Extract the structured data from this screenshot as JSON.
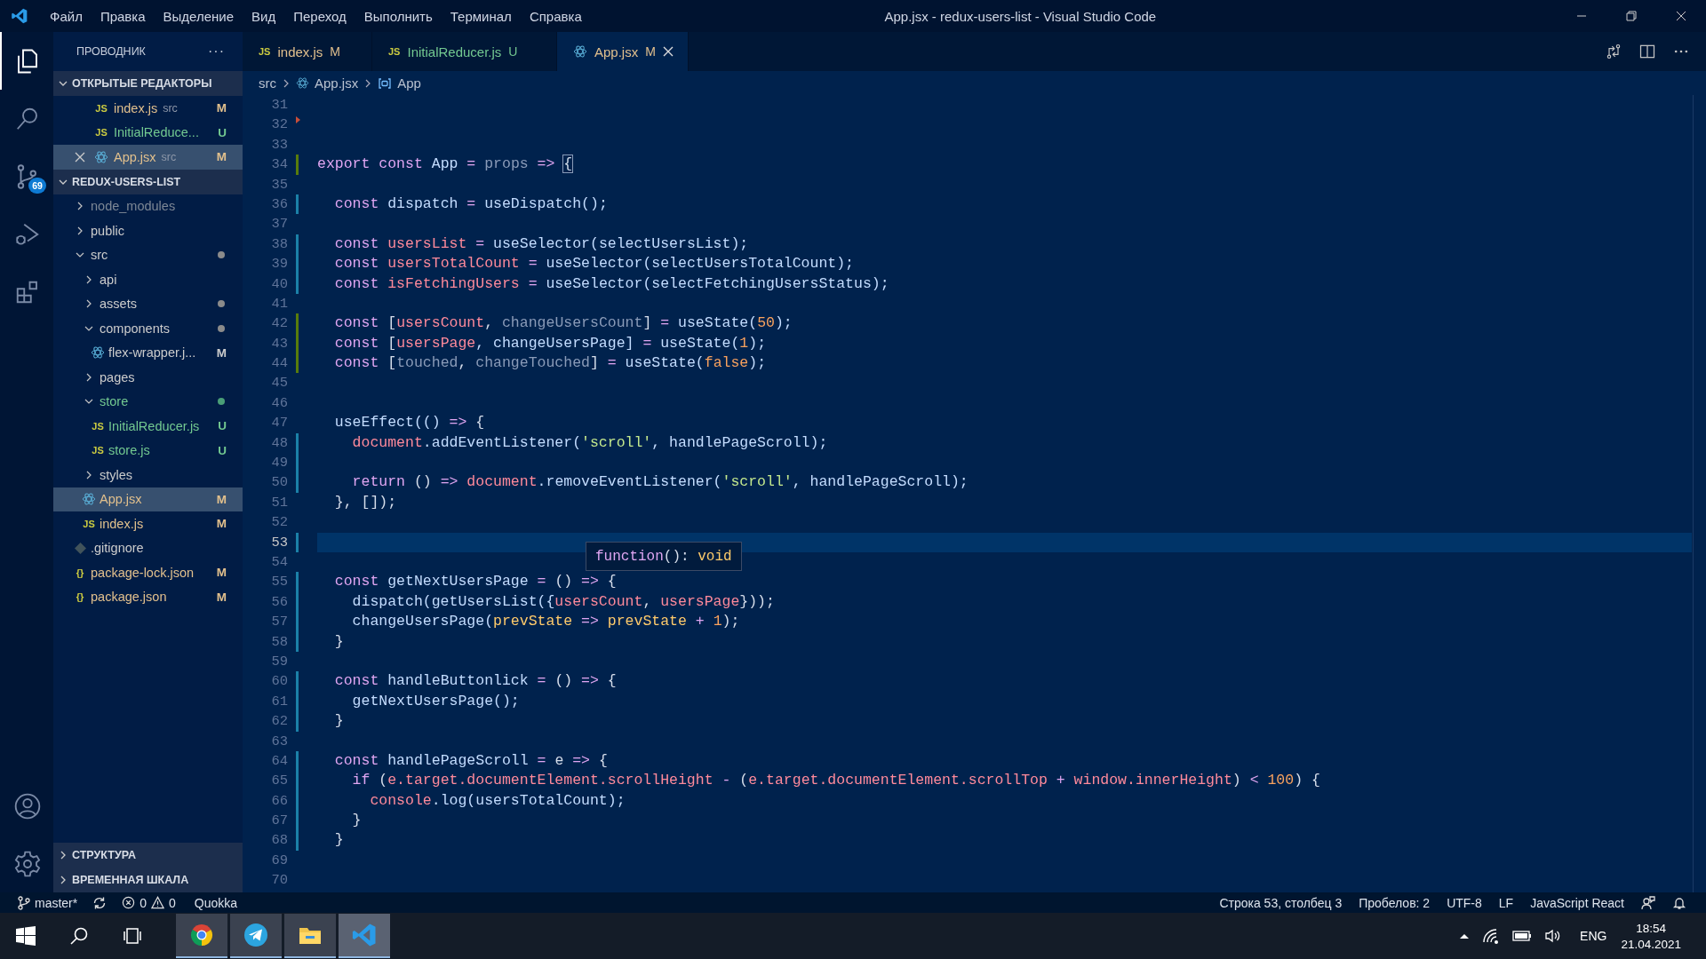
{
  "title_bar": {
    "menu": [
      "Файл",
      "Правка",
      "Выделение",
      "Вид",
      "Переход",
      "Выполнить",
      "Терминал",
      "Справка"
    ],
    "title": "App.jsx - redux-users-list - Visual Studio Code"
  },
  "activity_bar": {
    "items": [
      {
        "kind": "files",
        "selected": true
      },
      {
        "kind": "search",
        "selected": false
      },
      {
        "kind": "source-control",
        "selected": false,
        "badge": "69"
      },
      {
        "kind": "run",
        "selected": false
      },
      {
        "kind": "extensions",
        "selected": false
      }
    ],
    "bottom": [
      {
        "kind": "account"
      },
      {
        "kind": "gear"
      }
    ]
  },
  "explorer": {
    "title": "ПРОВОДНИК",
    "more": "···",
    "open_editors": {
      "title": "ОТКРЫТЫЕ РЕДАКТОРЫ",
      "expanded": true,
      "items": [
        {
          "name": "index.js",
          "description": "src",
          "status": "M",
          "color": "#e2c08d",
          "kind": "js",
          "icon_label": "JS",
          "selected": false
        },
        {
          "name": "InitialReduce...",
          "status": "U",
          "color": "#73c991",
          "kind": "js",
          "icon_label": "JS",
          "selected": false
        },
        {
          "name": "App.jsx",
          "description": "src",
          "status": "M",
          "color": "#e2c08d",
          "kind": "react",
          "selected": true
        }
      ]
    },
    "project": {
      "title": "REDUX-USERS-LIST",
      "expanded": true,
      "tree": [
        {
          "name": "node_modules",
          "kind": "folder",
          "expanded": false,
          "color": "#7d8795",
          "selected": false
        },
        {
          "name": "public",
          "kind": "folder",
          "expanded": false,
          "color": "#cccccc",
          "selected": false
        },
        {
          "name": "src",
          "kind": "folder",
          "expanded": true,
          "color": "#cccccc",
          "dot": {
            "color": "#8b8b8b"
          },
          "selected": false,
          "children": [
            {
              "name": "api",
              "kind": "folder",
              "expanded": false,
              "color": "#cccccc",
              "selected": false
            },
            {
              "name": "assets",
              "kind": "folder",
              "expanded": false,
              "color": "#cccccc",
              "dot": {
                "color": "#8b8b8b"
              },
              "selected": false
            },
            {
              "name": "components",
              "kind": "folder",
              "expanded": true,
              "color": "#cccccc",
              "dot": {
                "color": "#8b8b8b"
              },
              "selected": false,
              "children": [
                {
                  "name": "flex-wrapper.j...",
                  "kind": "react",
                  "color": "#cccccc",
                  "status": "M",
                  "selected": false
                }
              ]
            },
            {
              "name": "pages",
              "kind": "folder",
              "expanded": false,
              "color": "#cccccc",
              "selected": false
            },
            {
              "name": "store",
              "kind": "folder",
              "expanded": true,
              "color": "#73c991",
              "dot": {
                "color": "#4a9e77"
              },
              "selected": false,
              "children": [
                {
                  "name": "InitialReducer.js",
                  "kind": "js",
                  "icon_label": "JS",
                  "color": "#73c991",
                  "status": "U",
                  "selected": false
                },
                {
                  "name": "store.js",
                  "kind": "js",
                  "icon_label": "JS",
                  "color": "#73c991",
                  "status": "U",
                  "selected": false
                }
              ]
            },
            {
              "name": "styles",
              "kind": "folder",
              "expanded": false,
              "color": "#cccccc",
              "selected": false
            },
            {
              "name": "App.jsx",
              "kind": "react",
              "color": "#e2c08d",
              "status": "M",
              "selected": true
            },
            {
              "name": "index.js",
              "kind": "js",
              "icon_label": "JS",
              "color": "#e2c08d",
              "status": "M",
              "selected": false
            }
          ]
        },
        {
          "name": ".gitignore",
          "kind": "git",
          "color": "#cccccc",
          "selected": false
        },
        {
          "name": "package-lock.json",
          "kind": "json",
          "icon_label": "{}",
          "color": "#e2c08d",
          "status": "M",
          "selected": false
        },
        {
          "name": "package.json",
          "kind": "json",
          "icon_label": "{}",
          "color": "#e2c08d",
          "status": "M",
          "selected": false
        }
      ]
    },
    "sections": [
      {
        "title": "СТРУКТУРА",
        "expanded": false
      },
      {
        "title": "ВРЕМЕННАЯ ШКАЛА",
        "expanded": false
      }
    ]
  },
  "tabs": [
    {
      "name": "index.js",
      "status": "M",
      "color": "#e2c08d",
      "kind": "js",
      "icon_label": "JS",
      "selected": false
    },
    {
      "name": "InitialReducer.js",
      "status": "U",
      "color": "#73c991",
      "kind": "js",
      "icon_label": "JS",
      "selected": false
    },
    {
      "name": "App.jsx",
      "status": "M",
      "color": "#e2c08d",
      "kind": "react",
      "selected": true
    }
  ],
  "breadcrumb": [
    {
      "text": "src",
      "kind": "folder"
    },
    {
      "text": "App.jsx",
      "kind": "react"
    },
    {
      "text": "App",
      "kind": "symbol"
    }
  ],
  "editor": {
    "lines": [
      {
        "number": "31",
        "selected": false
      },
      {
        "number": "32",
        "selected": false,
        "marker": {
          "kind": "triangle",
          "color": "#c74e39"
        }
      },
      {
        "number": "33",
        "selected": false
      },
      {
        "number": "34",
        "selected": false,
        "marker": {
          "kind": "bar",
          "color": "#587c0c"
        },
        "tokens": [
          {
            "text": "export ",
            "kind": "kw"
          },
          {
            "text": "const ",
            "kind": "kw"
          },
          {
            "text": "App",
            "kind": "fn"
          },
          {
            "text": " = ",
            "kind": "op"
          },
          {
            "text": "props",
            "kind": "dim"
          },
          {
            "text": " => ",
            "kind": "op"
          },
          {
            "text": "{",
            "kind": "bracket"
          }
        ]
      },
      {
        "number": "35",
        "selected": false
      },
      {
        "number": "36",
        "selected": false,
        "marker": {
          "kind": "bar",
          "color": "#1b81a8"
        },
        "tokens": [
          {
            "text": "  const ",
            "kind": "kw"
          },
          {
            "text": "dispatch",
            "kind": "fn"
          },
          {
            "text": " = ",
            "kind": "op"
          },
          {
            "text": "useDispatch();",
            "kind": "fn"
          }
        ]
      },
      {
        "number": "37",
        "selected": false
      },
      {
        "number": "38",
        "selected": false,
        "marker": {
          "kind": "bar",
          "color": "#1b81a8"
        },
        "tokens": [
          {
            "text": "  const ",
            "kind": "kw"
          },
          {
            "text": "usersList",
            "kind": "var"
          },
          {
            "text": " = ",
            "kind": "op"
          },
          {
            "text": "useSelector(selectUsersList);",
            "kind": "fn"
          }
        ]
      },
      {
        "number": "39",
        "selected": false,
        "marker": {
          "kind": "bar",
          "color": "#1b81a8"
        },
        "tokens": [
          {
            "text": "  const ",
            "kind": "kw"
          },
          {
            "text": "usersTotalCount",
            "kind": "var"
          },
          {
            "text": " = ",
            "kind": "op"
          },
          {
            "text": "useSelector(selectUsersTotalCount);",
            "kind": "fn"
          }
        ]
      },
      {
        "number": "40",
        "selected": false,
        "marker": {
          "kind": "bar",
          "color": "#1b81a8"
        },
        "tokens": [
          {
            "text": "  const ",
            "kind": "kw"
          },
          {
            "text": "isFetchingUsers",
            "kind": "var"
          },
          {
            "text": " = ",
            "kind": "op"
          },
          {
            "text": "useSelector(selectFetchingUsersStatus);",
            "kind": "fn"
          }
        ]
      },
      {
        "number": "41",
        "selected": false
      },
      {
        "number": "42",
        "selected": false,
        "marker": {
          "kind": "bar",
          "color": "#587c0c"
        },
        "tokens": [
          {
            "text": "  const ",
            "kind": "kw"
          },
          {
            "text": "[",
            "kind": "plain"
          },
          {
            "text": "usersCount",
            "kind": "var"
          },
          {
            "text": ", ",
            "kind": "plain"
          },
          {
            "text": "changeUsersCount",
            "kind": "dim"
          },
          {
            "text": "] ",
            "kind": "plain"
          },
          {
            "text": "= ",
            "kind": "op"
          },
          {
            "text": "useState(",
            "kind": "fn"
          },
          {
            "text": "50",
            "kind": "num"
          },
          {
            "text": ");",
            "kind": "fn"
          }
        ]
      },
      {
        "number": "43",
        "selected": false,
        "marker": {
          "kind": "bar",
          "color": "#587c0c"
        },
        "tokens": [
          {
            "text": "  const ",
            "kind": "kw"
          },
          {
            "text": "[",
            "kind": "plain"
          },
          {
            "text": "usersPage",
            "kind": "var"
          },
          {
            "text": ", changeUsersPage] ",
            "kind": "fn"
          },
          {
            "text": "= ",
            "kind": "op"
          },
          {
            "text": "useState(",
            "kind": "fn"
          },
          {
            "text": "1",
            "kind": "num"
          },
          {
            "text": ");",
            "kind": "fn"
          }
        ]
      },
      {
        "number": "44",
        "selected": false,
        "marker": {
          "kind": "bar",
          "color": "#587c0c"
        },
        "tokens": [
          {
            "text": "  const ",
            "kind": "kw"
          },
          {
            "text": "[",
            "kind": "plain"
          },
          {
            "text": "touched",
            "kind": "dim"
          },
          {
            "text": ", ",
            "kind": "plain"
          },
          {
            "text": "changeTouched",
            "kind": "dim"
          },
          {
            "text": "] ",
            "kind": "plain"
          },
          {
            "text": "= ",
            "kind": "op"
          },
          {
            "text": "useState(",
            "kind": "fn"
          },
          {
            "text": "false",
            "kind": "num"
          },
          {
            "text": ");",
            "kind": "fn"
          }
        ]
      },
      {
        "number": "45",
        "selected": false
      },
      {
        "number": "46",
        "selected": false
      },
      {
        "number": "47",
        "selected": false,
        "tokens": [
          {
            "text": "  useEffect(() ",
            "kind": "fn"
          },
          {
            "text": "=>",
            "kind": "op"
          },
          {
            "text": " {",
            "kind": "plain"
          }
        ]
      },
      {
        "number": "48",
        "selected": false,
        "marker": {
          "kind": "bar",
          "color": "#1b81a8"
        },
        "tokens": [
          {
            "text": "    document",
            "kind": "var"
          },
          {
            "text": ".addEventListener(",
            "kind": "fn"
          },
          {
            "text": "'scroll'",
            "kind": "str"
          },
          {
            "text": ", handlePageScroll);",
            "kind": "fn"
          }
        ]
      },
      {
        "number": "49",
        "selected": false,
        "marker": {
          "kind": "bar",
          "color": "#1b81a8"
        }
      },
      {
        "number": "50",
        "selected": false,
        "marker": {
          "kind": "bar",
          "color": "#1b81a8"
        },
        "tokens": [
          {
            "text": "    return ",
            "kind": "kw"
          },
          {
            "text": "() ",
            "kind": "plain"
          },
          {
            "text": "=> ",
            "kind": "op"
          },
          {
            "text": "document",
            "kind": "var"
          },
          {
            "text": ".removeEventListener(",
            "kind": "fn"
          },
          {
            "text": "'scroll'",
            "kind": "str"
          },
          {
            "text": ", handlePageScroll);",
            "kind": "fn"
          }
        ]
      },
      {
        "number": "51",
        "selected": false,
        "tokens": [
          {
            "text": "  }, []);",
            "kind": "plain"
          }
        ]
      },
      {
        "number": "52",
        "selected": false
      },
      {
        "number": "53",
        "selected": true,
        "marker": {
          "kind": "bar",
          "color": "#1b81a8"
        }
      },
      {
        "number": "54",
        "selected": false
      },
      {
        "number": "55",
        "selected": false,
        "marker": {
          "kind": "bar",
          "color": "#1b81a8"
        },
        "tokens": [
          {
            "text": "  const ",
            "kind": "kw"
          },
          {
            "text": "getNextUsersPage",
            "kind": "fn"
          },
          {
            "text": " = ",
            "kind": "op"
          },
          {
            "text": "() ",
            "kind": "plain"
          },
          {
            "text": "=>",
            "kind": "op"
          },
          {
            "text": " {",
            "kind": "plain"
          }
        ]
      },
      {
        "number": "56",
        "selected": false,
        "marker": {
          "kind": "bar",
          "color": "#1b81a8"
        },
        "tokens": [
          {
            "text": "    dispatch(getUsersList({",
            "kind": "fn"
          },
          {
            "text": "usersCount",
            "kind": "var"
          },
          {
            "text": ", ",
            "kind": "plain"
          },
          {
            "text": "usersPage",
            "kind": "var"
          },
          {
            "text": "}));",
            "kind": "plain"
          }
        ]
      },
      {
        "number": "57",
        "selected": false,
        "marker": {
          "kind": "bar",
          "color": "#1b81a8"
        },
        "tokens": [
          {
            "text": "    changeUsersPage(",
            "kind": "fn"
          },
          {
            "text": "prevState",
            "kind": "param"
          },
          {
            "text": " => ",
            "kind": "op"
          },
          {
            "text": "prevState",
            "kind": "param"
          },
          {
            "text": " + ",
            "kind": "op"
          },
          {
            "text": "1",
            "kind": "num"
          },
          {
            "text": ");",
            "kind": "plain"
          }
        ]
      },
      {
        "number": "58",
        "selected": false,
        "marker": {
          "kind": "bar",
          "color": "#1b81a8"
        },
        "tokens": [
          {
            "text": "  }",
            "kind": "plain"
          }
        ]
      },
      {
        "number": "59",
        "selected": false
      },
      {
        "number": "60",
        "selected": false,
        "marker": {
          "kind": "bar",
          "color": "#1b81a8"
        },
        "tokens": [
          {
            "text": "  const ",
            "kind": "kw"
          },
          {
            "text": "handleButtonlick",
            "kind": "fn"
          },
          {
            "text": " = ",
            "kind": "op"
          },
          {
            "text": "() ",
            "kind": "plain"
          },
          {
            "text": "=>",
            "kind": "op"
          },
          {
            "text": " {",
            "kind": "plain"
          }
        ]
      },
      {
        "number": "61",
        "selected": false,
        "marker": {
          "kind": "bar",
          "color": "#1b81a8"
        },
        "tokens": [
          {
            "text": "    getNextUsersPage();",
            "kind": "fn"
          }
        ]
      },
      {
        "number": "62",
        "selected": false,
        "marker": {
          "kind": "bar",
          "color": "#1b81a8"
        },
        "tokens": [
          {
            "text": "  }",
            "kind": "plain"
          }
        ]
      },
      {
        "number": "63",
        "selected": false
      },
      {
        "number": "64",
        "selected": false,
        "marker": {
          "kind": "bar",
          "color": "#1b81a8"
        },
        "tokens": [
          {
            "text": "  const ",
            "kind": "kw"
          },
          {
            "text": "handlePageScroll",
            "kind": "fn"
          },
          {
            "text": " = ",
            "kind": "op"
          },
          {
            "text": "e",
            "kind": "plain"
          },
          {
            "text": " => ",
            "kind": "op"
          },
          {
            "text": "{",
            "kind": "plain"
          }
        ]
      },
      {
        "number": "65",
        "selected": false,
        "marker": {
          "kind": "bar",
          "color": "#1b81a8"
        },
        "tokens": [
          {
            "text": "    if ",
            "kind": "kw"
          },
          {
            "text": "(",
            "kind": "plain"
          },
          {
            "text": "e.target.documentElement.scrollHeight",
            "kind": "var"
          },
          {
            "text": " - ",
            "kind": "op"
          },
          {
            "text": "(",
            "kind": "plain"
          },
          {
            "text": "e.target.documentElement.scrollTop",
            "kind": "var"
          },
          {
            "text": " + ",
            "kind": "op"
          },
          {
            "text": "window.innerHeight",
            "kind": "var"
          },
          {
            "text": ") ",
            "kind": "plain"
          },
          {
            "text": "< ",
            "kind": "op"
          },
          {
            "text": "100",
            "kind": "num"
          },
          {
            "text": ") {",
            "kind": "plain"
          }
        ]
      },
      {
        "number": "66",
        "selected": false,
        "marker": {
          "kind": "bar",
          "color": "#1b81a8"
        },
        "tokens": [
          {
            "text": "      console",
            "kind": "var"
          },
          {
            "text": ".log(usersTotalCount);",
            "kind": "fn"
          }
        ]
      },
      {
        "number": "67",
        "selected": false,
        "marker": {
          "kind": "bar",
          "color": "#1b81a8"
        },
        "tokens": [
          {
            "text": "    }",
            "kind": "plain"
          }
        ]
      },
      {
        "number": "68",
        "selected": false,
        "marker": {
          "kind": "bar",
          "color": "#1b81a8"
        },
        "tokens": [
          {
            "text": "  }",
            "kind": "plain"
          }
        ]
      },
      {
        "number": "69",
        "selected": false
      },
      {
        "number": "70",
        "selected": false
      }
    ],
    "hover": {
      "tokens": [
        {
          "text": "function",
          "kind": "kw"
        },
        {
          "text": "(): ",
          "kind": "plain"
        },
        {
          "text": "void",
          "kind": "param"
        }
      ]
    }
  },
  "status_bar": {
    "branch": "master*",
    "errors": "0",
    "warnings": "0",
    "quokka": "Quokka",
    "position": "Строка 53, столбец 3",
    "indent": "Пробелов: 2",
    "encoding": "UTF-8",
    "eol": "LF",
    "language": "JavaScript React"
  },
  "taskbar": {
    "apps": [
      {
        "kind": "round-logo",
        "selected": false
      },
      {
        "kind": "paper-plane",
        "selected": false
      },
      {
        "kind": "folder",
        "selected": false
      },
      {
        "kind": "ribbon-logo",
        "selected": true
      }
    ],
    "language": "ENG",
    "time": "18:54",
    "date": "21.04.2021"
  }
}
